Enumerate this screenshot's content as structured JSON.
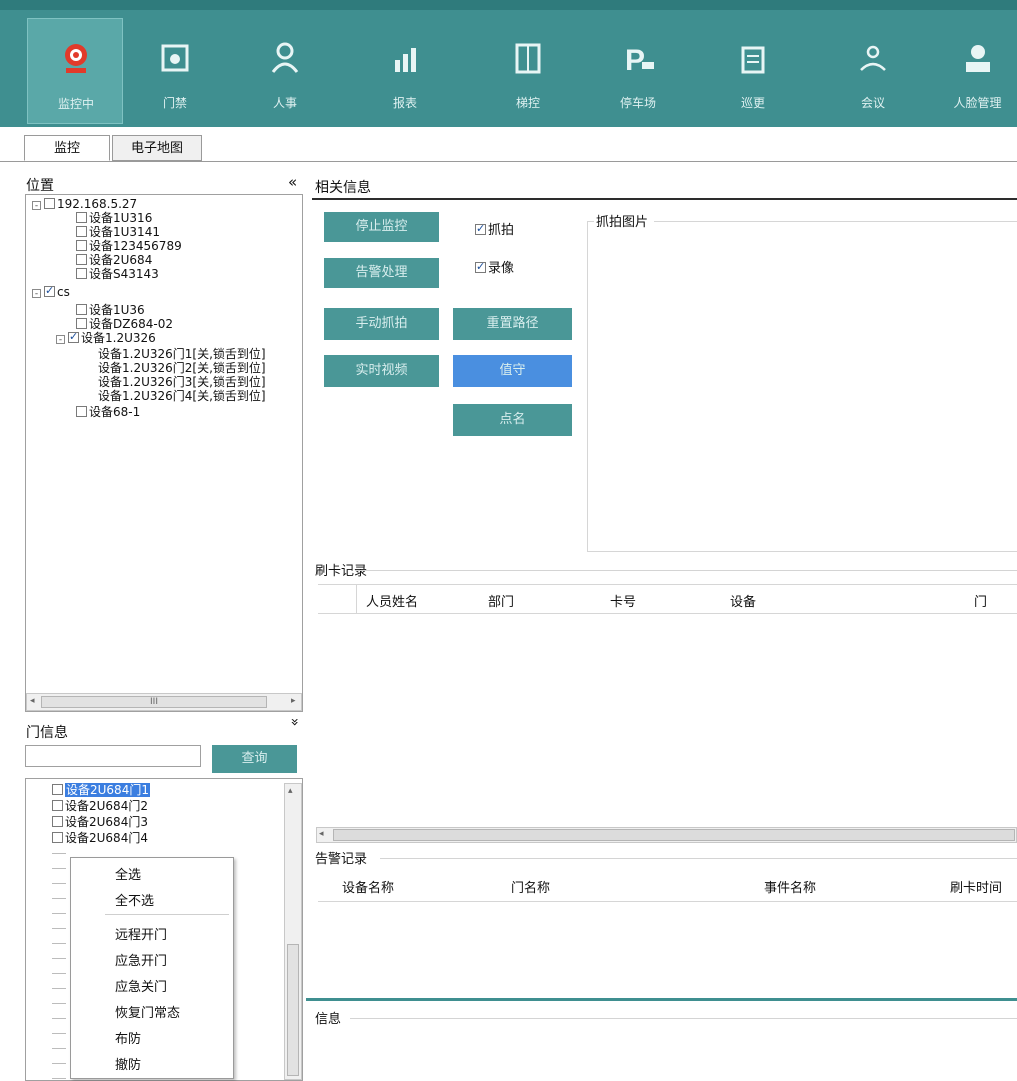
{
  "toolbar": {
    "items": [
      {
        "label": "监控中",
        "icon": "webcam-icon"
      },
      {
        "label": "门禁",
        "icon": "door-access-icon"
      },
      {
        "label": "人事",
        "icon": "person-icon"
      },
      {
        "label": "报表",
        "icon": "report-chart-icon"
      },
      {
        "label": "梯控",
        "icon": "elevator-icon"
      },
      {
        "label": "停车场",
        "icon": "parking-icon"
      },
      {
        "label": "巡更",
        "icon": "patrol-icon"
      },
      {
        "label": "会议",
        "icon": "meeting-icon"
      },
      {
        "label": "人脸管理",
        "icon": "face-management-icon"
      }
    ],
    "accent": "#3f8f90"
  },
  "tabs": [
    {
      "label": "监控"
    },
    {
      "label": "电子地图"
    }
  ],
  "location": {
    "title": "位置",
    "collapse_glyph": "«",
    "tree": [
      {
        "text": "192.168.5.27",
        "expander": "⊟"
      },
      {
        "text": "设备1U316"
      },
      {
        "text": "设备1U3141"
      },
      {
        "text": "设备123456789"
      },
      {
        "text": "设备2U684"
      },
      {
        "text": "设备S43143"
      },
      {
        "text": "cs",
        "expander": "⊟"
      },
      {
        "text": "设备1U36"
      },
      {
        "text": "设备DZ684-02"
      },
      {
        "text": "设备1.2U326",
        "expander": "⊟"
      },
      {
        "text": "设备1.2U326门1[关,锁舌到位]"
      },
      {
        "text": "设备1.2U326门2[关,锁舌到位]"
      },
      {
        "text": "设备1.2U326门3[关,锁舌到位]"
      },
      {
        "text": "设备1.2U326门4[关,锁舌到位]"
      },
      {
        "text": "设备68-1"
      }
    ],
    "scroll_thumb_glyph": "III"
  },
  "door_info": {
    "title": "门信息",
    "expand_glyph": "»",
    "search_value": "",
    "query_label": "查询",
    "list": [
      {
        "text": "设备2U684门1",
        "selected": true
      },
      {
        "text": "设备2U684门2"
      },
      {
        "text": "设备2U684门3"
      },
      {
        "text": "设备2U684门4"
      }
    ]
  },
  "context_menu": {
    "items": [
      "全选",
      "全不选",
      "远程开门",
      "应急开门",
      "应急关门",
      "恢复门常态",
      "布防",
      "撤防"
    ]
  },
  "related_info": {
    "title": "相关信息",
    "buttons": {
      "stop_monitor": "停止监控",
      "alarm_handle": "告警处理",
      "manual_capture": "手动抓拍",
      "reset_path": "重置路径",
      "realtime_video": "实时视频",
      "on_duty": "值守",
      "roll_call": "点名"
    },
    "checks": {
      "capture": "抓拍",
      "record": "录像"
    },
    "capture_image_title": "抓拍图片"
  },
  "card_records": {
    "title": "刷卡记录",
    "columns": [
      "人员姓名",
      "部门",
      "卡号",
      "设备",
      "门"
    ]
  },
  "alarm_records": {
    "title": "告警记录",
    "columns": [
      "设备名称",
      "门名称",
      "事件名称",
      "刷卡时间"
    ]
  },
  "info": {
    "title": "信息"
  }
}
